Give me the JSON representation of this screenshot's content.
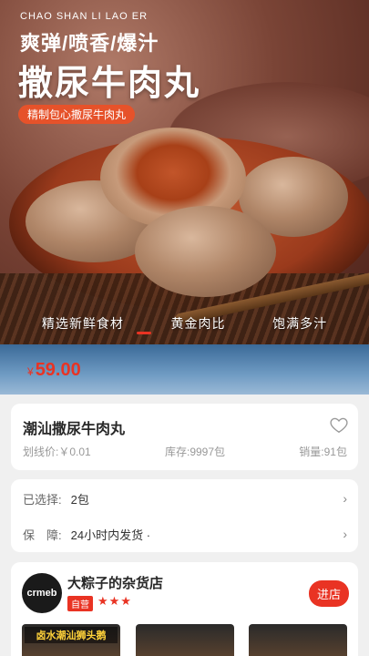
{
  "hero": {
    "pinyin": "CHAO SHAN LI LAO ER",
    "tagline": "爽弹/喷香/爆汁",
    "title": "撒尿牛肉丸",
    "badge": "精制包心撒尿牛肉丸",
    "features": [
      "精选新鲜食材",
      "黄金肉比",
      "饱满多汁"
    ]
  },
  "price": {
    "currency": "¥",
    "amount": "59.00"
  },
  "product": {
    "name": "潮汕撒尿牛肉丸",
    "original_price": "划线价:￥0.01",
    "stock": "库存:9997包",
    "sales": "销量:91包"
  },
  "selection": {
    "chosen_label": "已选择:",
    "chosen_value": "2包",
    "guarantee_label": "保　障:",
    "guarantee_value": "24小时内发货 ·"
  },
  "shop": {
    "logo_text": "crmeb",
    "name": "大粽子的杂货店",
    "tag": "自营",
    "stars": "★★★",
    "enter_label": "进店",
    "thumbs": [
      "卤水潮汕狮头鹅",
      "",
      ""
    ]
  },
  "colors": {
    "accent": "#e93323"
  }
}
